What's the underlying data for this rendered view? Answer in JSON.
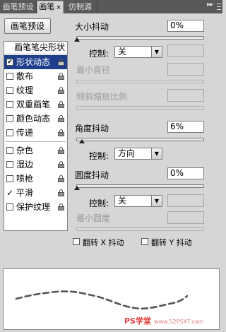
{
  "tabs": [
    {
      "label": "画笔预设",
      "active": false,
      "closable": false
    },
    {
      "label": "画笔",
      "active": true,
      "closable": true
    },
    {
      "label": "仿制源",
      "active": false,
      "closable": false
    }
  ],
  "menu_arrows": "▸▸",
  "preset_button_label": "画笔预设",
  "brush_list": {
    "header": "画笔笔尖形状",
    "items": [
      {
        "label": "形状动态",
        "checked": true,
        "selected": true
      },
      {
        "label": "散布",
        "checked": false,
        "selected": false
      },
      {
        "label": "纹理",
        "checked": false,
        "selected": false
      },
      {
        "label": "双重画笔",
        "checked": false,
        "selected": false
      },
      {
        "label": "颜色动态",
        "checked": false,
        "selected": false
      },
      {
        "label": "传递",
        "checked": false,
        "selected": false
      },
      {
        "label": "杂色",
        "checked": false,
        "selected": false
      },
      {
        "label": "湿边",
        "checked": false,
        "selected": false
      },
      {
        "label": "喷枪",
        "checked": false,
        "selected": false
      },
      {
        "label": "平滑",
        "checked": true,
        "selected": false
      },
      {
        "label": "保护纹理",
        "checked": false,
        "selected": false
      }
    ]
  },
  "size_jitter": {
    "label": "大小抖动",
    "value": "0%"
  },
  "size_control": {
    "label": "控制:",
    "value": "关"
  },
  "min_diameter": {
    "label": "最小直径"
  },
  "tilt_scale": {
    "label": "倾斜缩放比例"
  },
  "angle_jitter": {
    "label": "角度抖动",
    "value": "6%"
  },
  "angle_control": {
    "label": "控制:",
    "value": "方向"
  },
  "roundness_jitter": {
    "label": "圆度抖动",
    "value": "0%"
  },
  "roundness_control": {
    "label": "控制:",
    "value": "关"
  },
  "min_roundness": {
    "label": "最小圆度"
  },
  "flip_x": {
    "label": "翻转 X 抖动",
    "checked": false
  },
  "flip_y": {
    "label": "翻转 Y 抖动",
    "checked": false
  },
  "watermark": {
    "text": "PS学堂",
    "url": "www.52PSXT.com"
  },
  "chart_colors": {
    "stroke": "#555555"
  }
}
